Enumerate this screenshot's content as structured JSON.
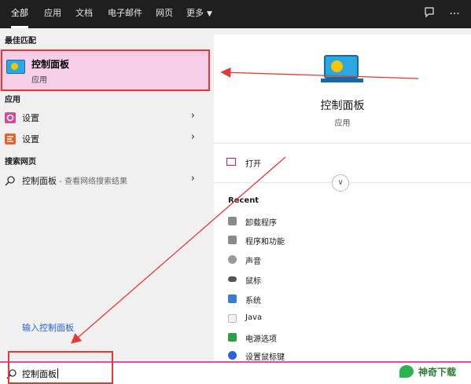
{
  "tabs": [
    {
      "label": "全部",
      "active": true
    },
    {
      "label": "应用"
    },
    {
      "label": "文档"
    },
    {
      "label": "电子邮件"
    },
    {
      "label": "网页"
    },
    {
      "label": "更多"
    }
  ],
  "top_icons": [
    "feedback-icon",
    "more-icon"
  ],
  "left": {
    "best_match_header": "最佳匹配",
    "best_match": {
      "title": "控制面板",
      "subtitle": "应用",
      "icon": "control-panel-icon"
    },
    "apps_header": "应用",
    "apps": [
      {
        "label": "设置",
        "icon": "settings-gear-icon"
      },
      {
        "label": "设置",
        "icon": "settings-alt-icon"
      }
    ],
    "web_header": "搜索网页",
    "web_item": {
      "label": "控制面板",
      "sub": " - 查看网络搜索结果"
    },
    "hint": "输入控制面板"
  },
  "right": {
    "title": "控制面板",
    "subtitle": "应用",
    "open_label": "打开",
    "recent_header": "Recent",
    "recent": [
      {
        "label": "卸载程序",
        "color": "#8a8a8a"
      },
      {
        "label": "程序和功能",
        "color": "#8a8a8a"
      },
      {
        "label": "声音",
        "color": "#9a9a9a"
      },
      {
        "label": "鼠标",
        "color": "#555555"
      },
      {
        "label": "系统",
        "color": "#3a7bd5"
      },
      {
        "label": "Java",
        "color": "#d35400"
      },
      {
        "label": "电源选项",
        "color": "#2e9e47"
      },
      {
        "label": "设置鼠标键",
        "color": "#2b63d6"
      }
    ]
  },
  "search": {
    "value": "控制面板"
  },
  "brand": {
    "name": "神奇下载"
  },
  "colors": {
    "accent_pink": "#e84a9e",
    "highlight_red": "#e53935",
    "selected_bg": "#f5cde6"
  }
}
